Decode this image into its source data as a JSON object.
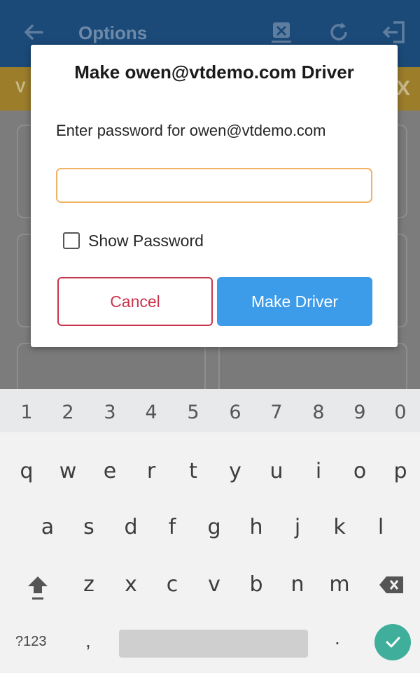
{
  "app": {
    "title": "Options",
    "subbar_text": "V",
    "subbar_close": "X"
  },
  "dialog": {
    "title": "Make owen@vtdemo.com Driver",
    "message": "Enter password for owen@vtdemo.com",
    "password_value": "",
    "show_password_label": "Show Password",
    "show_password_checked": false,
    "cancel_label": "Cancel",
    "confirm_label": "Make Driver"
  },
  "keyboard": {
    "number_row": [
      "1",
      "2",
      "3",
      "4",
      "5",
      "6",
      "7",
      "8",
      "9",
      "0"
    ],
    "row1": [
      "q",
      "w",
      "e",
      "r",
      "t",
      "y",
      "u",
      "i",
      "o",
      "p"
    ],
    "row2": [
      "a",
      "s",
      "d",
      "f",
      "g",
      "h",
      "j",
      "k",
      "l"
    ],
    "row3": [
      "z",
      "x",
      "c",
      "v",
      "b",
      "n",
      "m"
    ],
    "symbols_label": "?123",
    "comma": ",",
    "period": "."
  },
  "colors": {
    "appbar": "#1b4a79",
    "subbar": "#9b7d2a",
    "input_border": "#f2b266",
    "cancel": "#c9354d",
    "confirm": "#3d9cea",
    "enter_key": "#3fae9a"
  }
}
